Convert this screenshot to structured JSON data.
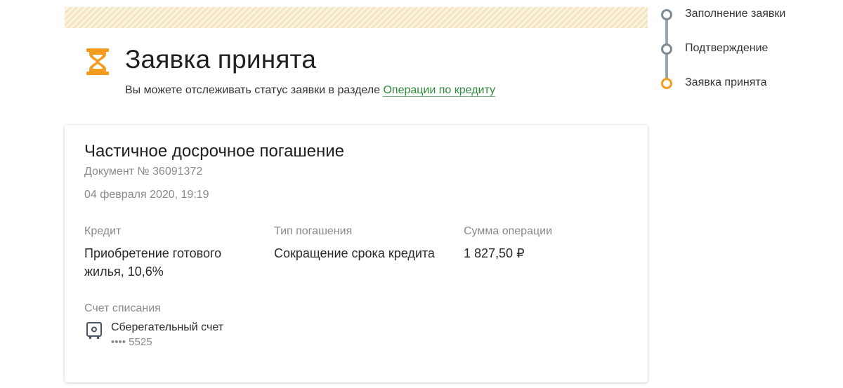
{
  "header": {
    "title": "Заявка принята",
    "subtitle_prefix": "Вы можете отслеживать статус заявки в разделе ",
    "subtitle_link": "Операции по кредиту",
    "icon": "hourglass-icon"
  },
  "card": {
    "title": "Частичное досрочное погашение",
    "document": "Документ № 36091372",
    "date": "04 февраля 2020, 19:19",
    "credit_label": "Кредит",
    "credit_value": "Приобретение готового жилья, 10,6%",
    "repayment_type_label": "Тип погашения",
    "repayment_type_value": "Сокращение срока кредита",
    "amount_label": "Сумма операции",
    "amount_value": "1 827,50 ₽",
    "debit_account_label": "Счет списания",
    "account_name": "Сберегательный счет",
    "account_number": "•••• 5525",
    "account_icon": "safe-icon"
  },
  "stepper": {
    "steps": [
      {
        "label": "Заполнение заявки",
        "state": "done"
      },
      {
        "label": "Подтверждение",
        "state": "done"
      },
      {
        "label": "Заявка принята",
        "state": "current"
      }
    ]
  },
  "colors": {
    "accent_orange": "#f39c1f",
    "link_green": "#2e8a3a",
    "stepper_gray": "#7d8b95",
    "banner_stripe": "#f3e4c2"
  }
}
